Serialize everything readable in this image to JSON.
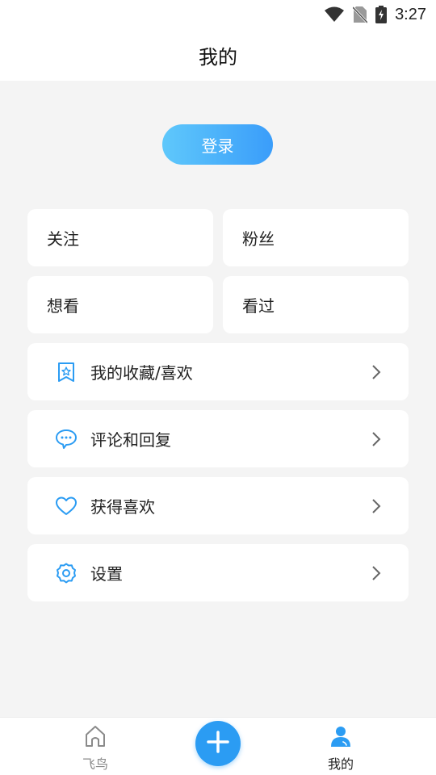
{
  "status_bar": {
    "time": "3:27"
  },
  "header": {
    "title": "我的"
  },
  "login": {
    "label": "登录"
  },
  "stats": {
    "follow": "关注",
    "fans": "粉丝",
    "want_to_watch": "想看",
    "watched": "看过"
  },
  "menu": {
    "items": [
      {
        "label": "我的收藏/喜欢",
        "icon": "bookmark-star-icon"
      },
      {
        "label": "评论和回复",
        "icon": "comment-bubble-icon"
      },
      {
        "label": "获得喜欢",
        "icon": "heart-icon"
      },
      {
        "label": "设置",
        "icon": "gear-icon"
      }
    ]
  },
  "bottom_nav": {
    "home_label": "飞鸟",
    "mine_label": "我的",
    "active": "mine"
  },
  "colors": {
    "accent": "#2b9cf3",
    "login_gradient_start": "#5fc8fb",
    "login_gradient_end": "#3a9dfa",
    "background": "#f4f4f4"
  }
}
